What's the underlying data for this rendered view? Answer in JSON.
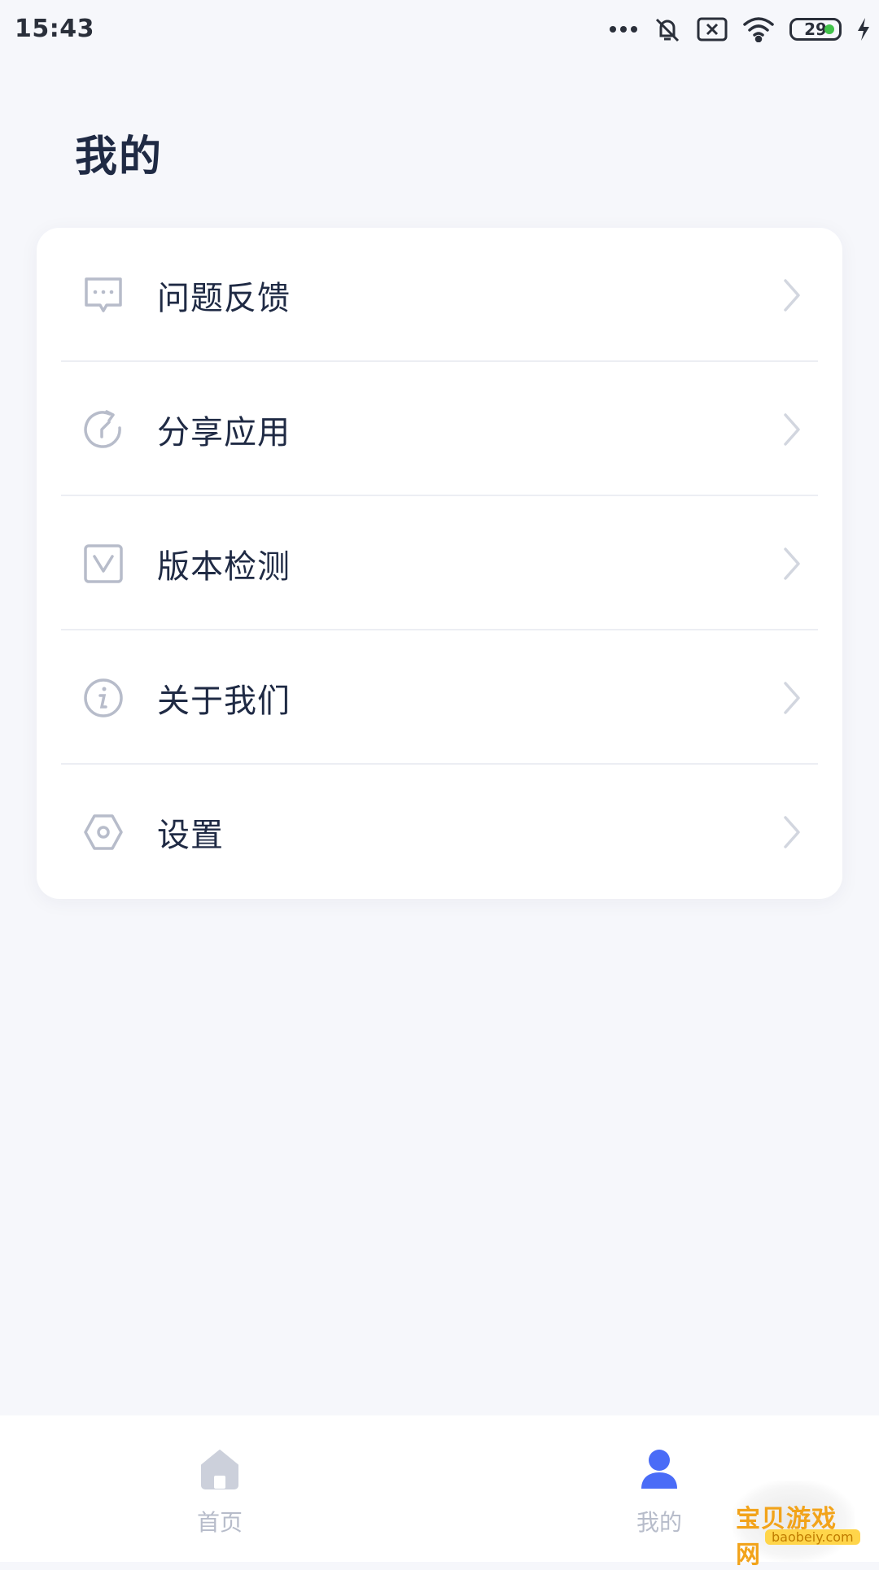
{
  "status_bar": {
    "time": "15:43",
    "battery_level": "29",
    "icons": [
      "more-dots-icon",
      "bell-muted-icon",
      "sim-x-icon",
      "wifi-icon",
      "battery-icon",
      "charging-bolt-icon"
    ]
  },
  "page": {
    "title": "我的"
  },
  "menu": {
    "items": [
      {
        "label": "问题反馈",
        "icon": "feedback-icon"
      },
      {
        "label": "分享应用",
        "icon": "share-icon"
      },
      {
        "label": "版本检测",
        "icon": "version-check-icon"
      },
      {
        "label": "关于我们",
        "icon": "info-icon"
      },
      {
        "label": "设置",
        "icon": "settings-icon"
      }
    ]
  },
  "bottom_nav": {
    "items": [
      {
        "label": "首页",
        "icon": "home-icon",
        "active": false
      },
      {
        "label": "我的",
        "icon": "user-icon",
        "active": true
      }
    ]
  },
  "watermark": {
    "text": "宝贝游戏网",
    "url": "baobeiy.com"
  },
  "colors": {
    "background": "#f6f7fb",
    "card": "#ffffff",
    "text_primary": "#1f2a44",
    "icon_gray": "#b7bcca",
    "accent_blue": "#4a6cf7",
    "battery_green": "#41c24a"
  }
}
